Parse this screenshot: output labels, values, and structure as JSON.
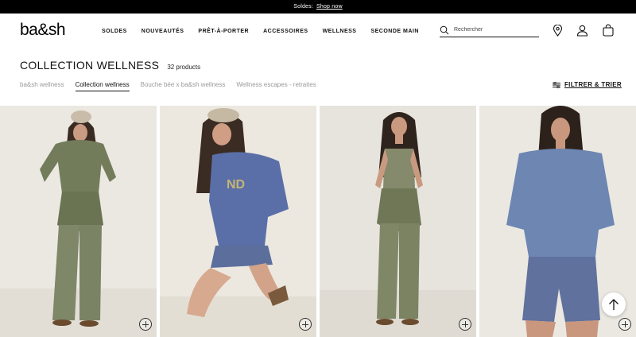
{
  "promo": {
    "text": "Soldes:",
    "link": "Shop now"
  },
  "header": {
    "logo": "ba&sh",
    "nav": [
      "SOLDES",
      "NOUVEAUTÉS",
      "PRÊT-À-PORTER",
      "ACCESSOIRES",
      "WELLNESS",
      "SECONDE MAIN"
    ],
    "search_placeholder": "Rechercher",
    "icons": [
      "search-icon",
      "store-locator-icon",
      "account-icon",
      "bag-icon"
    ]
  },
  "collection": {
    "title": "COLLECTION WELLNESS",
    "count": "32 products",
    "tabs": [
      "ba&sh wellness",
      "Collection wellness",
      "Bouche bée x ba&sh wellness",
      "Wellness escapes - retraites"
    ],
    "active_tab": "Collection wellness",
    "filter_label": "FILTRER & TRIER"
  },
  "products": [
    {
      "image": "model-khaki-tee-cargo-pants",
      "bg": "#e9e6e0",
      "top": "#737c5a",
      "bottom": "#7e8768"
    },
    {
      "image": "model-blue-sweatshirt-kneeling",
      "bg": "#ebe7df",
      "top": "#5a6fa8",
      "bottom": "#5b6e9c"
    },
    {
      "image": "model-khaki-tank-pants",
      "bg": "#e7e4de",
      "top": "#848a6b",
      "bottom": "#7f8767"
    },
    {
      "image": "model-blue-tee-shorts",
      "bg": "#ebe8e2",
      "top": "#6d86b2",
      "bottom": "#5f719c"
    }
  ],
  "colors": {
    "promo_bg": "#000000",
    "text": "#111111",
    "muted": "#9a9a9a"
  }
}
